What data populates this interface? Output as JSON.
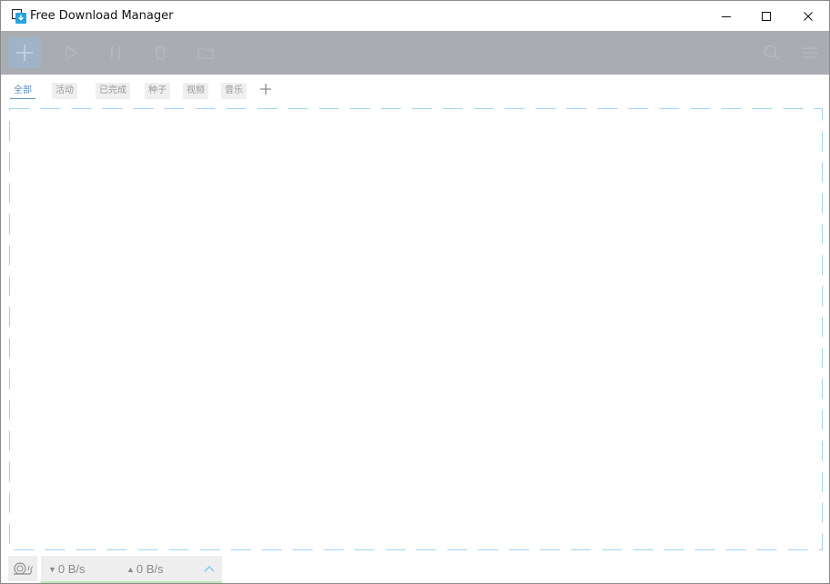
{
  "window": {
    "title": "Free Download Manager",
    "controls": [
      "minimize-icon",
      "maximize-icon",
      "close-icon"
    ]
  },
  "toolbar": {
    "left_icons": [
      "add-icon",
      "play-icon",
      "pause-icon",
      "delete-icon",
      "folder-icon"
    ],
    "right_icons": [
      "search-icon",
      "menu-icon"
    ],
    "colors": {
      "background": "#a9acb1",
      "add_button": "#9fb4c8"
    }
  },
  "tabs": {
    "items": [
      "全部",
      "活动",
      "已完成",
      "种子",
      "视频",
      "音乐"
    ],
    "active_index": 0,
    "add_icon": "plus-icon"
  },
  "status": {
    "download_speed": "0 B/s",
    "upload_speed": "0 B/s",
    "snail_icon": "snail-icon",
    "toggle_icon": "chevron-up-icon"
  }
}
